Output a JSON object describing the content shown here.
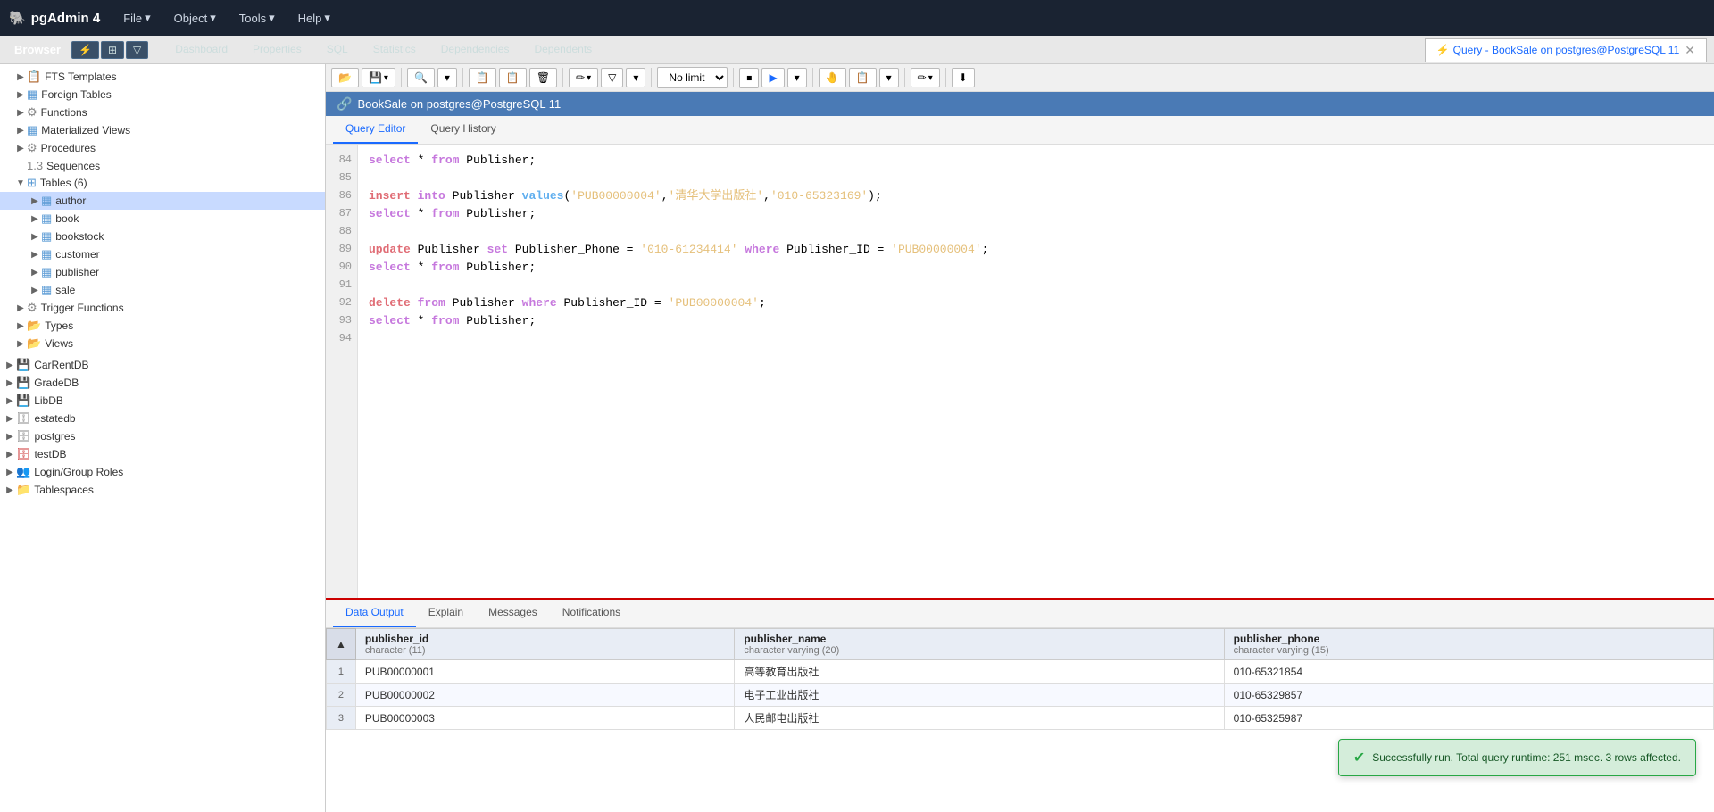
{
  "app": {
    "title": "pgAdmin 4",
    "logo": "🐘"
  },
  "top_nav": {
    "menu_items": [
      "File",
      "Object",
      "Tools",
      "Help"
    ]
  },
  "browser": {
    "label": "Browser"
  },
  "panel_tabs": [
    {
      "label": "Dashboard"
    },
    {
      "label": "Properties"
    },
    {
      "label": "SQL"
    },
    {
      "label": "Statistics"
    },
    {
      "label": "Dependencies"
    },
    {
      "label": "Dependents"
    }
  ],
  "query_tab": {
    "label": "Query - BookSale on postgres@PostgreSQL 11",
    "modified": true
  },
  "connection": {
    "label": "BookSale on postgres@PostgreSQL 11"
  },
  "editor_tabs": [
    {
      "label": "Query Editor",
      "active": true
    },
    {
      "label": "Query History",
      "active": false
    }
  ],
  "results_tabs": [
    {
      "label": "Data Output",
      "active": true
    },
    {
      "label": "Explain"
    },
    {
      "label": "Messages"
    },
    {
      "label": "Notifications"
    }
  ],
  "no_limit": "No limit",
  "sidebar_items": [
    {
      "id": "fts-templates",
      "label": "FTS Templates",
      "icon": "📋",
      "indent": 1,
      "arrow": "▶"
    },
    {
      "id": "foreign-tables",
      "label": "Foreign Tables",
      "icon": "📊",
      "indent": 1,
      "arrow": "▶"
    },
    {
      "id": "functions",
      "label": "Functions",
      "icon": "⚙",
      "indent": 1,
      "arrow": "▶"
    },
    {
      "id": "materialized-views",
      "label": "Materialized Views",
      "icon": "📋",
      "indent": 1,
      "arrow": "▶"
    },
    {
      "id": "procedures",
      "label": "Procedures",
      "icon": "⚙",
      "indent": 1,
      "arrow": "▶"
    },
    {
      "id": "sequences",
      "label": "Sequences",
      "icon": "🔢",
      "indent": 1,
      "arrow": ""
    },
    {
      "id": "tables",
      "label": "Tables (6)",
      "icon": "🗂",
      "indent": 1,
      "arrow": "▼",
      "expanded": true
    },
    {
      "id": "author",
      "label": "author",
      "icon": "📋",
      "indent": 2,
      "arrow": "▶",
      "selected": true
    },
    {
      "id": "book",
      "label": "book",
      "icon": "📋",
      "indent": 2,
      "arrow": "▶"
    },
    {
      "id": "bookstock",
      "label": "bookstock",
      "icon": "📋",
      "indent": 2,
      "arrow": "▶"
    },
    {
      "id": "customer",
      "label": "customer",
      "icon": "📋",
      "indent": 2,
      "arrow": "▶"
    },
    {
      "id": "publisher",
      "label": "publisher",
      "icon": "📋",
      "indent": 2,
      "arrow": "▶"
    },
    {
      "id": "sale",
      "label": "sale",
      "icon": "📋",
      "indent": 2,
      "arrow": "▶"
    },
    {
      "id": "trigger-functions",
      "label": "Trigger Functions",
      "icon": "⚙",
      "indent": 1,
      "arrow": "▶"
    },
    {
      "id": "types",
      "label": "Types",
      "icon": "📂",
      "indent": 1,
      "arrow": "▶"
    },
    {
      "id": "views",
      "label": "Views",
      "icon": "📂",
      "indent": 1,
      "arrow": "▶"
    },
    {
      "id": "carrentdb",
      "label": "CarRentDB",
      "icon": "💾",
      "indent": 0,
      "arrow": "▶"
    },
    {
      "id": "gradedb",
      "label": "GradeDB",
      "icon": "💾",
      "indent": 0,
      "arrow": "▶"
    },
    {
      "id": "libdb",
      "label": "LibDB",
      "icon": "💾",
      "indent": 0,
      "arrow": "▶"
    },
    {
      "id": "estatedb",
      "label": "estatedb",
      "icon": "🗄",
      "indent": 0,
      "arrow": "▶"
    },
    {
      "id": "postgres",
      "label": "postgres",
      "icon": "🗄",
      "indent": 0,
      "arrow": "▶"
    },
    {
      "id": "testdb",
      "label": "testDB",
      "icon": "🗄",
      "indent": 0,
      "arrow": "▶"
    },
    {
      "id": "login-group-roles",
      "label": "Login/Group Roles",
      "icon": "👥",
      "indent": 0,
      "arrow": "▶"
    },
    {
      "id": "tablespaces",
      "label": "Tablespaces",
      "icon": "📁",
      "indent": 0,
      "arrow": "▶"
    }
  ],
  "code_lines": [
    {
      "num": 84,
      "content": "select * from Publisher;",
      "parts": [
        {
          "text": "select",
          "cls": "kw-select"
        },
        {
          "text": " * "
        },
        {
          "text": "from",
          "cls": "kw-from"
        },
        {
          "text": " Publisher;"
        }
      ]
    },
    {
      "num": 85,
      "content": ""
    },
    {
      "num": 86,
      "content": "insert into Publisher values('PUB00000004','清华大学出版社','010-65323169');",
      "parts": [
        {
          "text": "insert",
          "cls": "kw-insert"
        },
        {
          "text": " "
        },
        {
          "text": "into",
          "cls": "kw-into"
        },
        {
          "text": " Publisher "
        },
        {
          "text": "values",
          "cls": "kw-values"
        },
        {
          "text": "("
        },
        {
          "text": "'PUB00000004'",
          "cls": "str-val"
        },
        {
          "text": ","
        },
        {
          "text": "'清华大学出版社'",
          "cls": "str-val"
        },
        {
          "text": ","
        },
        {
          "text": "'010-65323169'",
          "cls": "str-val"
        },
        {
          "text": ");"
        }
      ]
    },
    {
      "num": 87,
      "content": "select * from Publisher;",
      "parts": [
        {
          "text": "select",
          "cls": "kw-select"
        },
        {
          "text": " * "
        },
        {
          "text": "from",
          "cls": "kw-from"
        },
        {
          "text": " Publisher;"
        }
      ]
    },
    {
      "num": 88,
      "content": ""
    },
    {
      "num": 89,
      "content": "update Publisher set Publisher_Phone = '010-61234414' where Publisher_ID = 'PUB00000004';",
      "parts": [
        {
          "text": "update",
          "cls": "kw-update"
        },
        {
          "text": " Publisher "
        },
        {
          "text": "set",
          "cls": "kw-set"
        },
        {
          "text": " Publisher_Phone = "
        },
        {
          "text": "'010-61234414'",
          "cls": "str-val"
        },
        {
          "text": " "
        },
        {
          "text": "where",
          "cls": "kw-where"
        },
        {
          "text": " Publisher_ID = "
        },
        {
          "text": "'PUB00000004'",
          "cls": "str-val"
        },
        {
          "text": ";"
        }
      ]
    },
    {
      "num": 90,
      "content": "select * from Publisher;",
      "parts": [
        {
          "text": "select",
          "cls": "kw-select"
        },
        {
          "text": " * "
        },
        {
          "text": "from",
          "cls": "kw-from"
        },
        {
          "text": " Publisher;"
        }
      ]
    },
    {
      "num": 91,
      "content": ""
    },
    {
      "num": 92,
      "content": "delete from Publisher where Publisher_ID = 'PUB00000004';",
      "parts": [
        {
          "text": "delete",
          "cls": "kw-delete"
        },
        {
          "text": " "
        },
        {
          "text": "from",
          "cls": "kw-from"
        },
        {
          "text": " Publisher "
        },
        {
          "text": "where",
          "cls": "kw-where"
        },
        {
          "text": " Publisher_ID = "
        },
        {
          "text": "'PUB00000004'",
          "cls": "str-val"
        },
        {
          "text": ";"
        }
      ]
    },
    {
      "num": 93,
      "content": "select * from Publisher;",
      "parts": [
        {
          "text": "select",
          "cls": "kw-select"
        },
        {
          "text": " * "
        },
        {
          "text": "from",
          "cls": "kw-from"
        },
        {
          "text": " Publisher;"
        }
      ]
    },
    {
      "num": 94,
      "content": ""
    }
  ],
  "table": {
    "columns": [
      {
        "name": "publisher_id",
        "type": "character (11)"
      },
      {
        "name": "publisher_name",
        "type": "character varying (20)"
      },
      {
        "name": "publisher_phone",
        "type": "character varying (15)"
      }
    ],
    "rows": [
      {
        "num": 1,
        "id": "PUB00000001",
        "name": "高等教育出版社",
        "phone": "010-65321854"
      },
      {
        "num": 2,
        "id": "PUB00000002",
        "name": "电子工业出版社",
        "phone": "010-65329857"
      },
      {
        "num": 3,
        "id": "PUB00000003",
        "name": "人民邮电出版社",
        "phone": "010-65325987"
      }
    ]
  },
  "toast": {
    "message": "Successfully run. Total query runtime: 251 msec. 3 rows affected."
  },
  "toolbar": {
    "open_file": "📂",
    "save": "💾",
    "search": "🔍",
    "copy": "📋",
    "paste": "📋",
    "delete": "🗑",
    "edit": "✏",
    "filter": "🔽",
    "stop": "⏹",
    "run": "▶",
    "explain": "🤚",
    "view": "📋",
    "download": "⬇"
  }
}
